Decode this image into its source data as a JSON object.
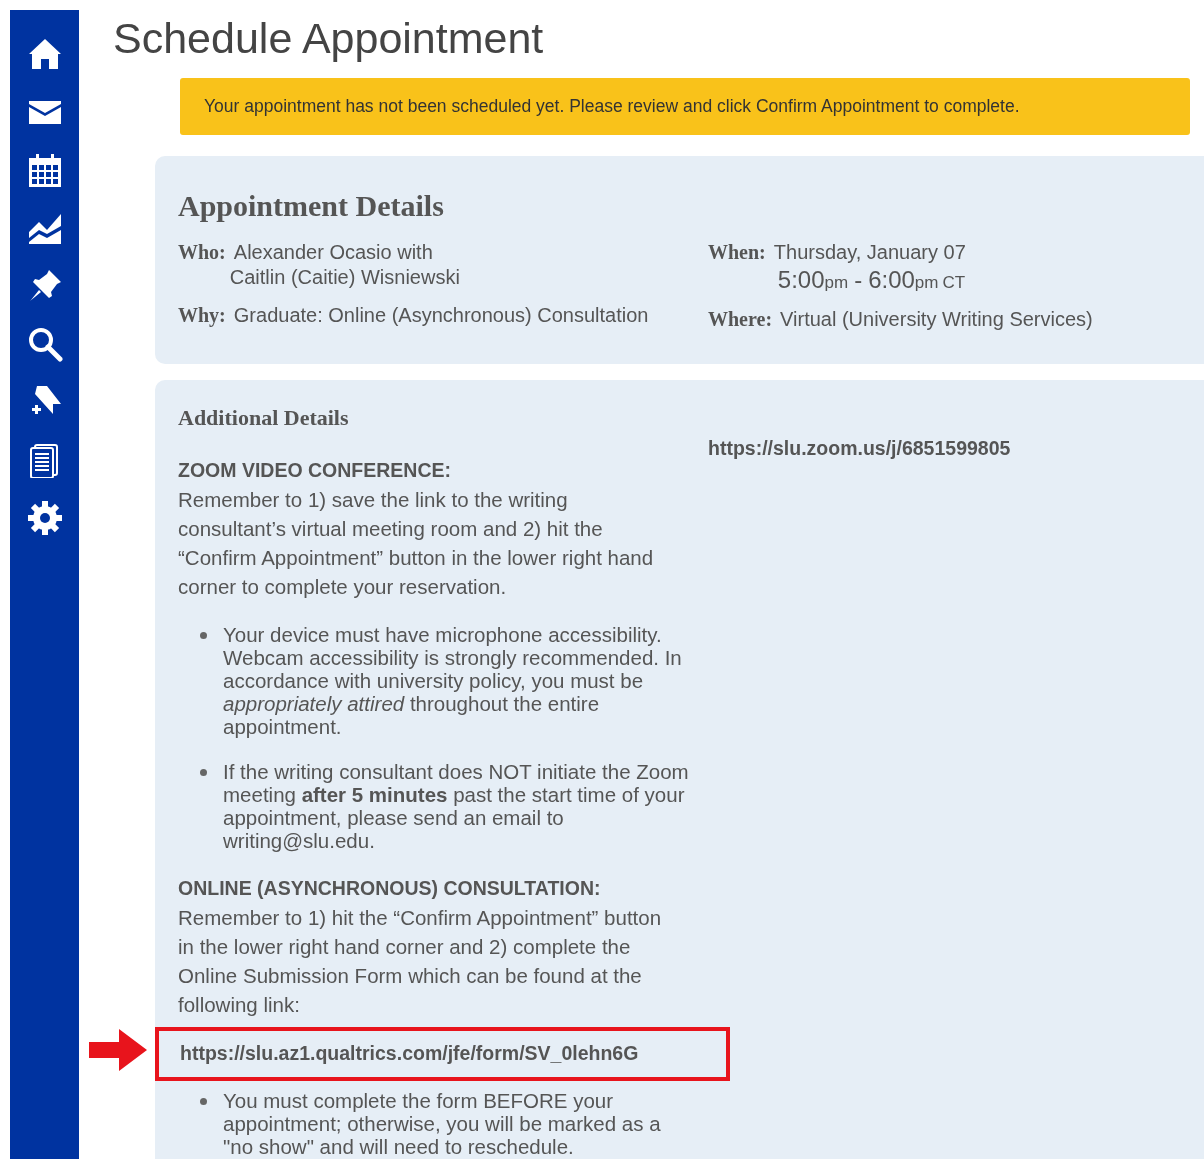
{
  "page_title": "Schedule Appointment",
  "alert": "Your appointment has not been scheduled yet. Please review and click Confirm Appointment to complete.",
  "details": {
    "heading": "Appointment Details",
    "who": {
      "label": "Who:",
      "lines": [
        "Alexander Ocasio with",
        "Caitlin (Caitie) Wisniewski"
      ]
    },
    "why": {
      "label": "Why:",
      "value": "Graduate: Online (Asynchronous) Consultation"
    },
    "when": {
      "label": "When:",
      "date": "Thursday, January 07",
      "start": "5:00",
      "start_suffix": "pm",
      "separator": "-",
      "end": "6:00",
      "end_suffix": "pm",
      "zone": "CT"
    },
    "where": {
      "label": "Where:",
      "value": "Virtual (University Writing Services)"
    }
  },
  "additional": {
    "heading": "Additional Details",
    "zoom_link": "https://slu.zoom.us/j/6851599805",
    "sections": [
      {
        "heading": "ZOOM VIDEO CONFERENCE:",
        "text": "Remember to 1) save the link to the writing consultant’s virtual meeting room and 2) hit the “Confirm Appointment” button in the lower right hand corner to complete your reservation.",
        "bullets": [
          "Your device must have microphone accessibility. Webcam accessibility is strongly recommended. In accordance with university policy, you must be *appropriately attired* throughout the entire appointment.",
          "If the writing consultant does NOT initiate the Zoom meeting **after 5 minutes** past the start time of your appointment, please send an email to writing@slu.edu."
        ]
      },
      {
        "heading": "ONLINE (ASYNCHRONOUS) CONSULTATION:",
        "text": "Remember to 1) hit the “Confirm Appointment” button in the lower right hand corner and 2) complete the Online Submission Form which can be found at the following link:",
        "link": "https://slu.az1.qualtrics.com/jfe/form/SV_0lehn6G",
        "highlighted": true,
        "bullets": [
          "You must complete the form BEFORE your appointment; otherwise, you will be marked as a \"no show\" and will need to reschedule."
        ]
      }
    ]
  }
}
